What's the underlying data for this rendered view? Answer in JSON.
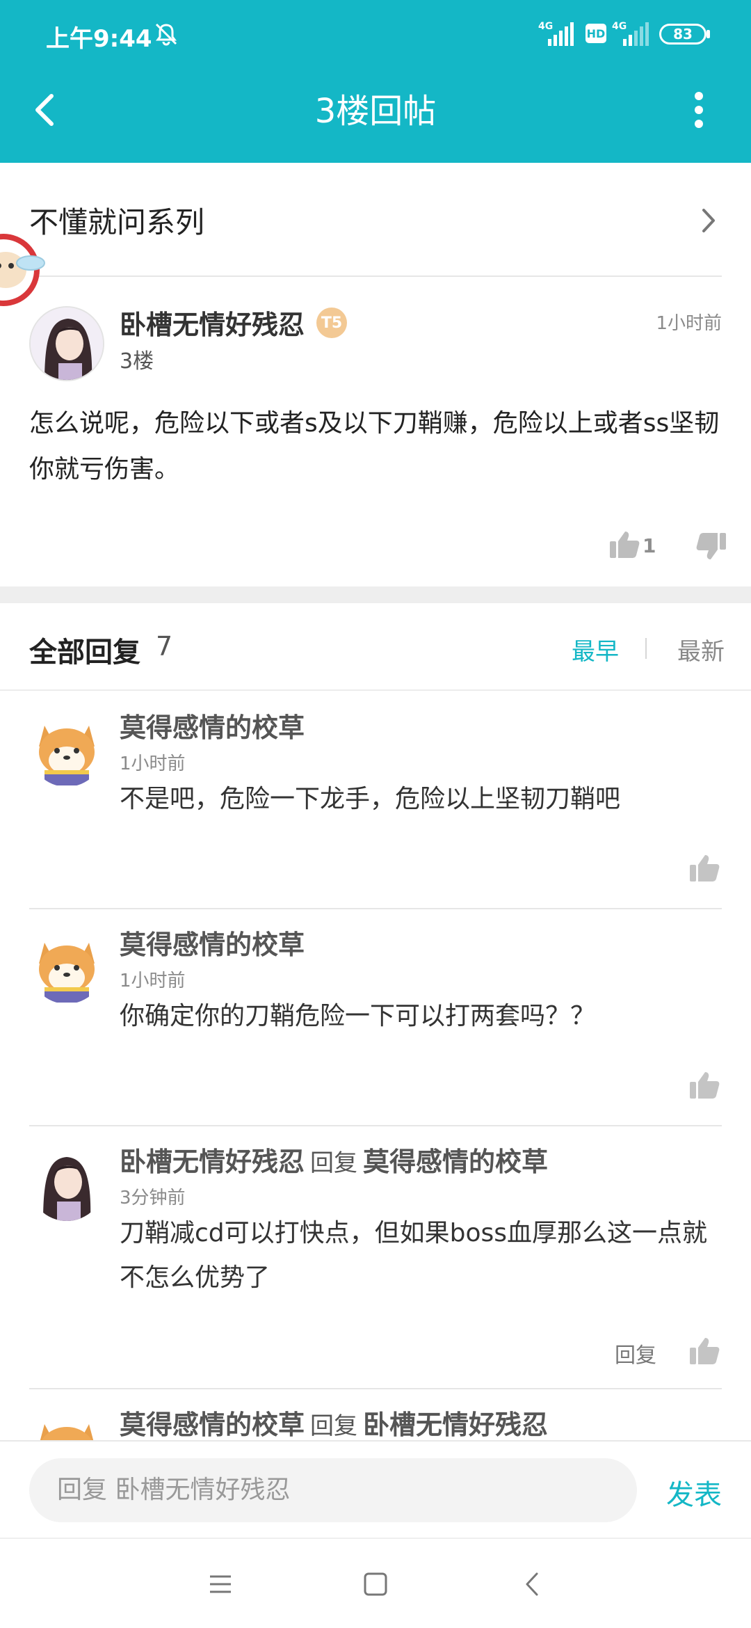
{
  "status": {
    "time": "上午9:44",
    "network1": "4G",
    "hd": "HD",
    "network2": "4G",
    "battery": "83"
  },
  "header": {
    "title": "3楼回帖"
  },
  "topic": {
    "label": "不懂就问系列"
  },
  "post": {
    "author": "卧槽无情好残忍",
    "level_badge": "T5",
    "floor": "3楼",
    "time": "1小时前",
    "content": "怎么说呢，危险以下或者s及以下刀鞘赚，危险以上或者ss坚韧你就亏伤害。",
    "likes": "1"
  },
  "replies_header": {
    "label": "全部回复",
    "count": "7",
    "sort_earliest": "最早",
    "sort_latest": "最新"
  },
  "replies": [
    {
      "name": "莫得感情的校草",
      "time": "1小时前",
      "text": "不是吧，危险一下龙手，危险以上坚韧刀鞘吧"
    },
    {
      "name": "莫得感情的校草",
      "time": "1小时前",
      "text": "你确定你的刀鞘危险一下可以打两套吗？？"
    },
    {
      "name": "卧槽无情好残忍",
      "reply_word": "回复",
      "reply_to": "莫得感情的校草",
      "time": "3分钟前",
      "text": "刀鞘减cd可以打快点，但如果boss血厚那么这一点就不怎么优势了",
      "reply_button": "回复"
    },
    {
      "name": "莫得感情的校草",
      "reply_word": "回复",
      "reply_to": "卧槽无情好残忍"
    }
  ],
  "input": {
    "placeholder": "回复 卧槽无情好残忍",
    "send_label": "发表"
  },
  "colors": {
    "accent": "#14b7c6",
    "background": "#ffffff",
    "divider": "#e6e6e6"
  },
  "icons": {
    "mute": "bell-off-icon",
    "back": "back-arrow-icon",
    "more": "more-vertical-icon",
    "chevron": "chevron-right-icon",
    "like": "thumbs-up-icon",
    "dislike": "thumbs-down-icon",
    "nav_menu": "menu-icon",
    "nav_home": "home-square-icon",
    "nav_back": "nav-back-icon"
  }
}
